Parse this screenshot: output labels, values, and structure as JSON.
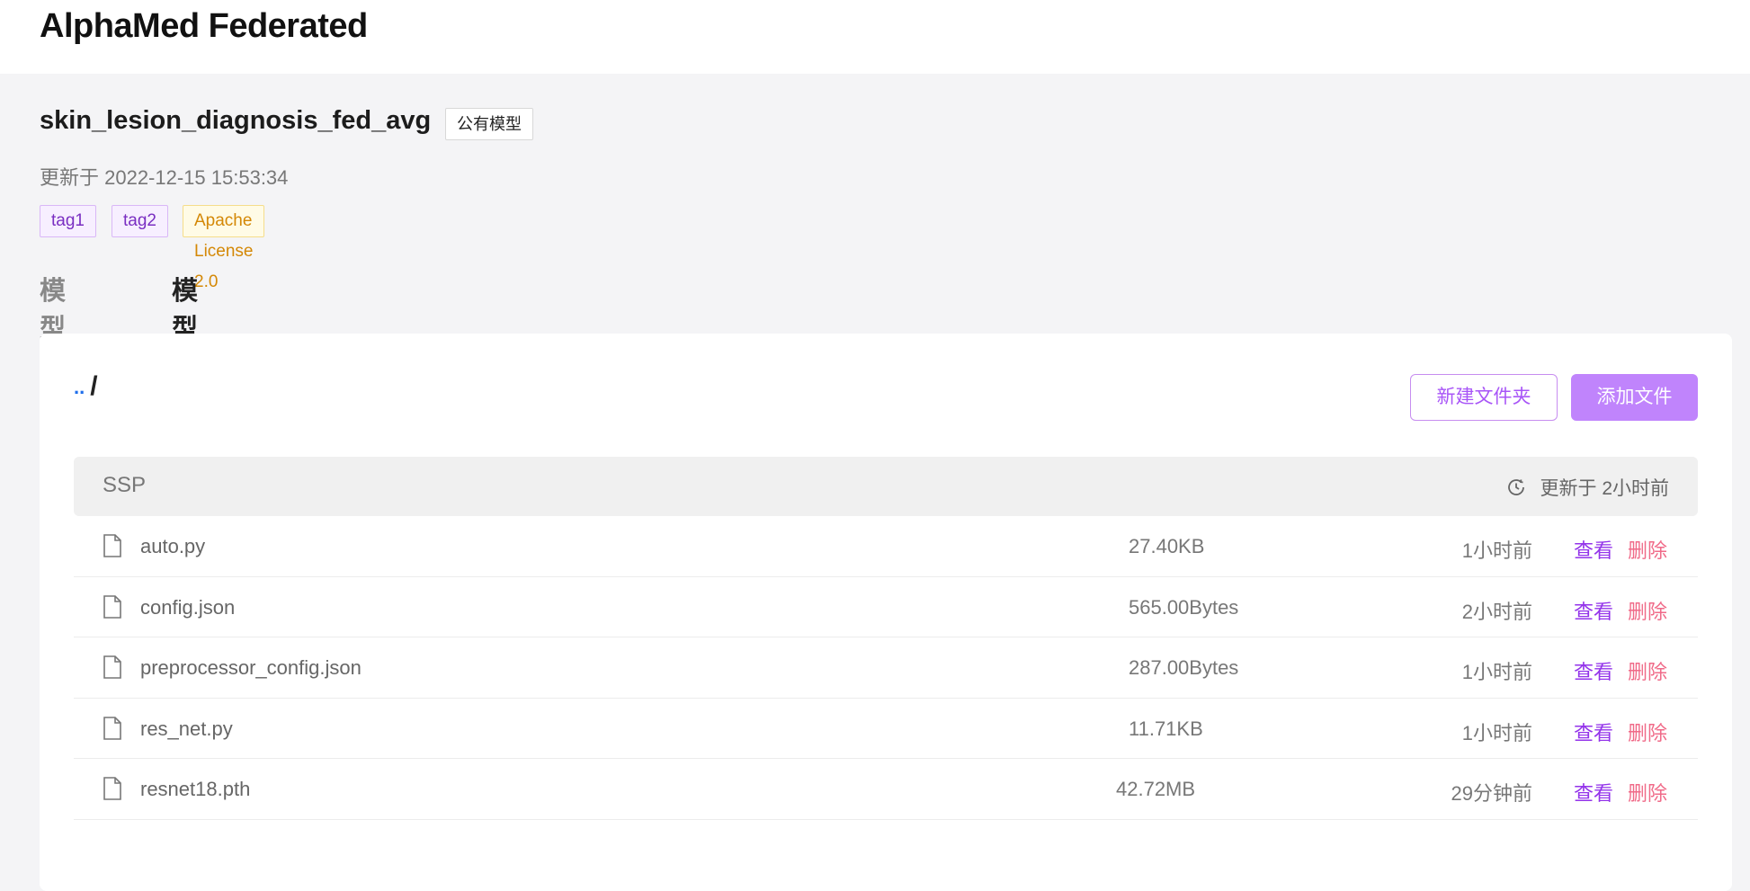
{
  "header": {
    "brand": "AlphaMed Federated"
  },
  "model": {
    "name": "skin_lesion_diagnosis_fed_avg",
    "visibility": "公有模型",
    "updated": "更新于 2022-12-15 15:53:34",
    "tags": [
      {
        "label": "tag1",
        "color": "#7a2fc2"
      },
      {
        "label": "tag2",
        "color": "#7a2fc2"
      },
      {
        "label": "Apache License 2.0",
        "color": "#d48806"
      }
    ]
  },
  "tabs": [
    {
      "label": "模型信息",
      "active": false
    },
    {
      "label": "模型文件",
      "active": true
    }
  ],
  "files_panel": {
    "path_dots": "..",
    "path": "/",
    "new_folder_label": "新建文件夹",
    "add_file_label": "添加文件",
    "folder": {
      "name": "SSP",
      "updated": "更新于 2小时前",
      "icon": "clock-icon"
    },
    "files": [
      {
        "name": "auto.py",
        "size": "27.40KB",
        "time": "1小时前",
        "view": "查看",
        "delete": "删除",
        "icon": "file-icon"
      },
      {
        "name": "config.json",
        "size": "565.00Bytes",
        "time": "2小时前",
        "view": "查看",
        "delete": "删除",
        "icon": "file-icon"
      },
      {
        "name": "preprocessor_config.json",
        "size": "287.00Bytes",
        "time": "1小时前",
        "view": "查看",
        "delete": "删除",
        "icon": "file-icon"
      },
      {
        "name": "res_net.py",
        "size": "11.71KB",
        "time": "1小时前",
        "view": "查看",
        "delete": "删除",
        "icon": "file-icon"
      },
      {
        "name": "resnet18.pth",
        "size": "42.72MB",
        "time": "29分钟前",
        "view": "查看",
        "delete": "删除",
        "icon": "file-icon"
      }
    ]
  },
  "colors": {
    "accent_purple": "#c084fc",
    "link_purple": "#9333ea",
    "delete_pink": "#f06a88"
  }
}
